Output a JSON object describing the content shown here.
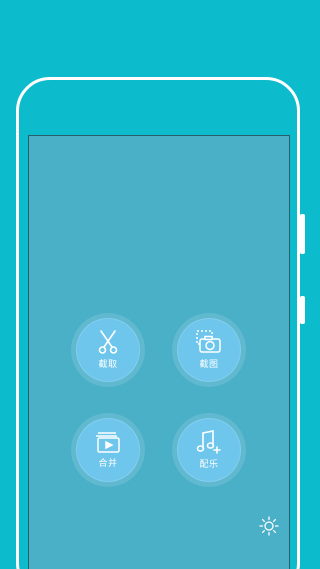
{
  "menu": {
    "trim_label": "截取",
    "screenshot_label": "截图",
    "merge_label": "合并",
    "music_label": "配乐"
  },
  "icons": {
    "trim": "scissors-icon",
    "screenshot": "camera-icon",
    "merge": "video-stack-icon",
    "music": "music-note-icon",
    "settings": "sun-icon"
  },
  "colors": {
    "background": "#0cbccc",
    "screen": "#4ab0c8",
    "tile": "#6ec6ec",
    "text": "#ffffff"
  }
}
